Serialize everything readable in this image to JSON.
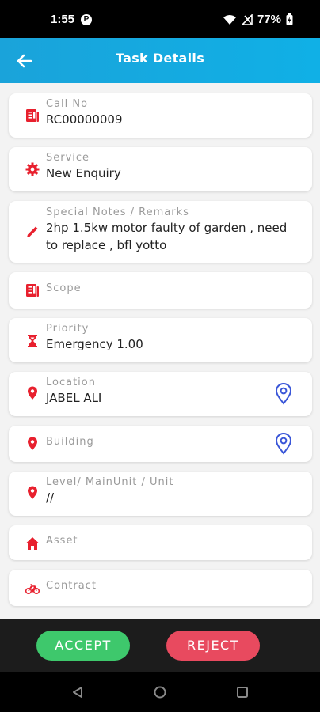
{
  "status_bar": {
    "time": "1:55",
    "battery": "77%",
    "notification_glyph": "P"
  },
  "app_bar": {
    "title": "Task Details"
  },
  "fields": {
    "call_no": {
      "label": "Call No",
      "value": "RC00000009",
      "icon": "document-icon"
    },
    "service": {
      "label": "Service",
      "value": "New Enquiry",
      "icon": "gear-icon"
    },
    "notes": {
      "label": "Special Notes / Remarks",
      "value": "2hp 1.5kw motor faulty of garden , need to replace , bfl yotto",
      "icon": "pencil-icon"
    },
    "scope": {
      "label": "Scope",
      "value": "",
      "icon": "document-icon"
    },
    "priority": {
      "label": "Priority",
      "value": "Emergency 1.00",
      "icon": "hourglass-icon"
    },
    "location": {
      "label": "Location",
      "value": "JABEL ALI",
      "icon": "location-pin-icon"
    },
    "building": {
      "label": "Building",
      "value": "",
      "icon": "location-pin-icon"
    },
    "level": {
      "label": "Level/ MainUnit / Unit",
      "value": "//",
      "icon": "location-pin-icon"
    },
    "asset": {
      "label": "Asset",
      "value": "",
      "icon": "home-icon"
    },
    "contract": {
      "label": "Contract",
      "value": "",
      "icon": "bicycle-icon"
    }
  },
  "actions": {
    "accept": "ACCEPT",
    "reject": "REJECT"
  },
  "colors": {
    "accent": "#14aadf",
    "icon_red": "#e8202e",
    "pin_blue": "#3a56d8",
    "accept": "#3ec86c",
    "reject": "#e84a5f"
  }
}
